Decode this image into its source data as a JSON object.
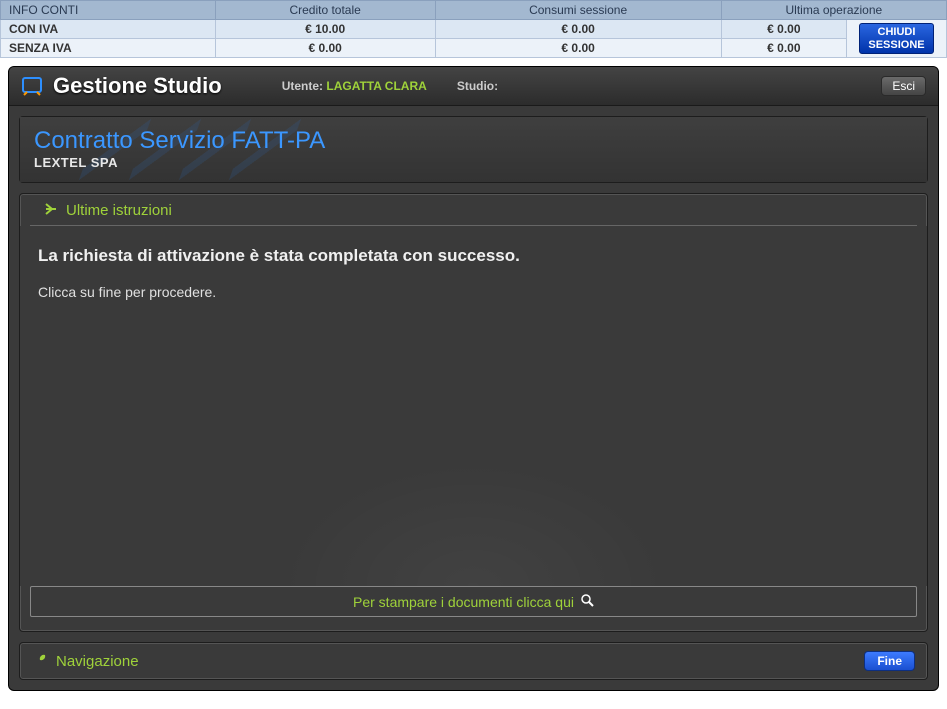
{
  "info_table": {
    "headers": [
      "INFO CONTI",
      "Credito totale",
      "Consumi sessione",
      "Ultima operazione"
    ],
    "rows": [
      {
        "label": "CON IVA",
        "credito": "€  10.00",
        "consumi": "€ 0.00",
        "ultima": "€ 0.00"
      },
      {
        "label": "SENZA IVA",
        "credito": "€  0.00",
        "consumi": "€ 0.00",
        "ultima": "€ 0.00"
      }
    ],
    "close_session": "CHIUDI\nSESSIONE"
  },
  "header": {
    "app_title": "Gestione Studio",
    "user_label": "Utente:",
    "user_name": "LAGATTA CLARA",
    "studio_label": "Studio:",
    "studio_name": "",
    "exit": "Esci"
  },
  "contract": {
    "title": "Contratto Servizio FATT-PA",
    "subtitle": "LEXTEL SPA"
  },
  "instructions": {
    "section_title": "Ultime istruzioni",
    "main": "La richiesta di attivazione è stata completata con successo.",
    "sub": "Clicca su fine per procedere.",
    "print": "Per stampare i documenti clicca qui"
  },
  "nav": {
    "title": "Navigazione",
    "fine": "Fine"
  }
}
